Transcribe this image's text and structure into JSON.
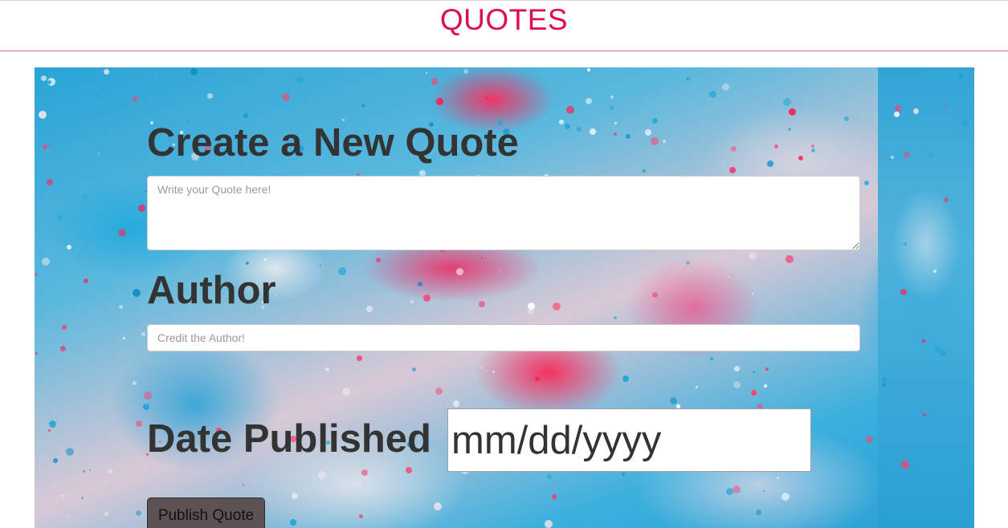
{
  "header": {
    "title": "QUOTES"
  },
  "form": {
    "quote_heading": "Create a New Quote",
    "quote_placeholder": "Write your Quote here!",
    "author_heading": "Author",
    "author_placeholder": "Credit the Author!",
    "date_heading": "Date Published",
    "date_value": "mm/dd/yyyy",
    "publish_label": "Publish Quote"
  },
  "colors": {
    "brand": "#dc0f55",
    "heading_text": "#333333",
    "button_bg": "#5c5254"
  }
}
